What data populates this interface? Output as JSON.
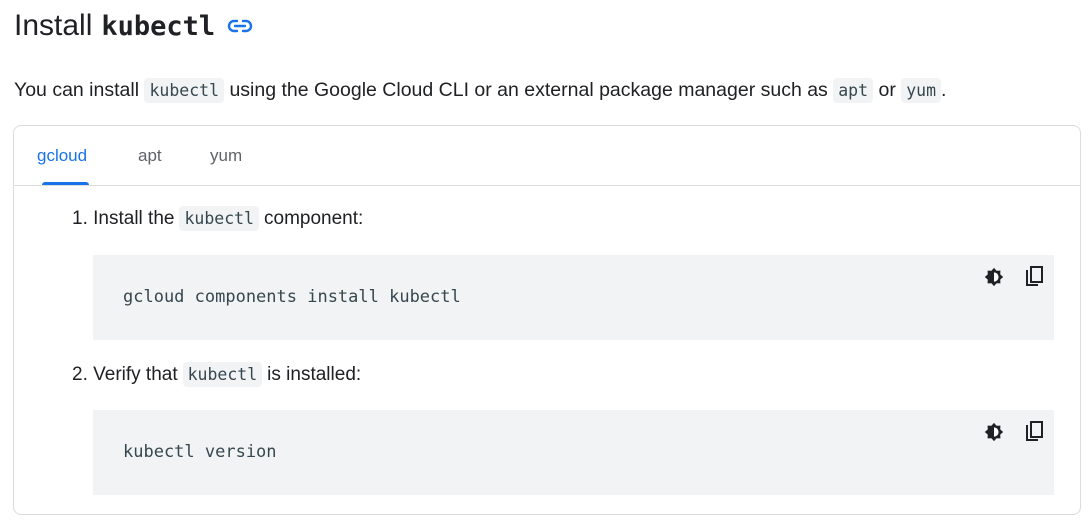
{
  "heading": {
    "prefix": "Install",
    "command": "kubectl"
  },
  "intro": {
    "text1": "You can install",
    "code1": "kubectl",
    "text2": "using the Google Cloud CLI or an external package manager such as",
    "code2": "apt",
    "text3": "or",
    "code3": "yum",
    "text4": "."
  },
  "tabs": [
    {
      "label": "gcloud",
      "active": true
    },
    {
      "label": "apt",
      "active": false
    },
    {
      "label": "yum",
      "active": false
    }
  ],
  "steps": [
    {
      "prefix": "1. Install the",
      "code": "kubectl",
      "suffix": "component:",
      "command": "gcloud components install kubectl"
    },
    {
      "prefix": "2. Verify that",
      "code": "kubectl",
      "suffix": "is installed:",
      "command": "kubectl version"
    }
  ],
  "colors": {
    "accent": "#1a73e8",
    "code_bg": "#f1f3f4",
    "border": "#dadce0"
  },
  "icons": [
    "link-icon",
    "dark-theme-toggle-icon",
    "copy-icon"
  ]
}
